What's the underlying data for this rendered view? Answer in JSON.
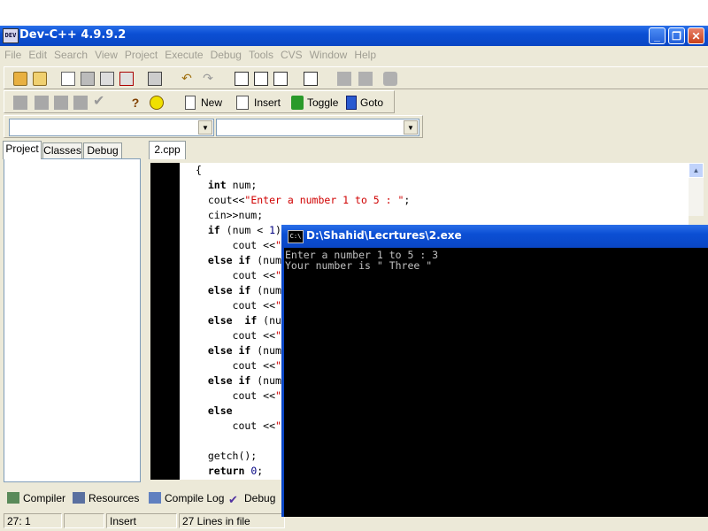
{
  "window": {
    "title": "Dev-C++ 4.9.9.2",
    "app_icon_text": "DEV"
  },
  "menu": [
    "File",
    "Edit",
    "Search",
    "View",
    "Project",
    "Execute",
    "Debug",
    "Tools",
    "CVS",
    "Window",
    "Help"
  ],
  "toolbar2": {
    "new_label": "New",
    "insert_label": "Insert",
    "toggle_label": "Toggle",
    "goto_label": "Goto"
  },
  "left_tabs": [
    "Project",
    "Classes",
    "Debug"
  ],
  "editor": {
    "file_tab": "2.cpp",
    "lines": [
      [
        {
          "t": "{",
          "c": "plain"
        }
      ],
      [
        {
          "t": "  ",
          "c": "plain"
        },
        {
          "t": "int",
          "c": "kw"
        },
        {
          "t": " num;",
          "c": "plain"
        }
      ],
      [
        {
          "t": "  cout<<",
          "c": "plain"
        },
        {
          "t": "\"Enter a number 1 to 5 : \"",
          "c": "str"
        },
        {
          "t": ";",
          "c": "plain"
        }
      ],
      [
        {
          "t": "  cin>>num;",
          "c": "plain"
        }
      ],
      [
        {
          "t": "  ",
          "c": "plain"
        },
        {
          "t": "if",
          "c": "kw"
        },
        {
          "t": " (num < ",
          "c": "plain"
        },
        {
          "t": "1",
          "c": "num"
        },
        {
          "t": ")",
          "c": "plain"
        }
      ],
      [
        {
          "t": "      cout <<",
          "c": "plain"
        },
        {
          "t": "\"",
          "c": "str"
        }
      ],
      [
        {
          "t": "  ",
          "c": "plain"
        },
        {
          "t": "else if",
          "c": "kw"
        },
        {
          "t": " (num",
          "c": "plain"
        }
      ],
      [
        {
          "t": "      cout <<",
          "c": "plain"
        },
        {
          "t": "\"",
          "c": "str"
        }
      ],
      [
        {
          "t": "  ",
          "c": "plain"
        },
        {
          "t": "else if",
          "c": "kw"
        },
        {
          "t": " (num",
          "c": "plain"
        }
      ],
      [
        {
          "t": "      cout <<",
          "c": "plain"
        },
        {
          "t": "\"",
          "c": "str"
        }
      ],
      [
        {
          "t": "  ",
          "c": "plain"
        },
        {
          "t": "else  if",
          "c": "kw"
        },
        {
          "t": " (nu",
          "c": "plain"
        }
      ],
      [
        {
          "t": "      cout <<",
          "c": "plain"
        },
        {
          "t": "\"",
          "c": "str"
        }
      ],
      [
        {
          "t": "  ",
          "c": "plain"
        },
        {
          "t": "else if",
          "c": "kw"
        },
        {
          "t": " (num",
          "c": "plain"
        }
      ],
      [
        {
          "t": "      cout <<",
          "c": "plain"
        },
        {
          "t": "\"",
          "c": "str"
        }
      ],
      [
        {
          "t": "  ",
          "c": "plain"
        },
        {
          "t": "else if",
          "c": "kw"
        },
        {
          "t": " (num",
          "c": "plain"
        }
      ],
      [
        {
          "t": "      cout <<",
          "c": "plain"
        },
        {
          "t": "\"",
          "c": "str"
        }
      ],
      [
        {
          "t": "  ",
          "c": "plain"
        },
        {
          "t": "else",
          "c": "kw"
        }
      ],
      [
        {
          "t": "      cout <<",
          "c": "plain"
        },
        {
          "t": "\"",
          "c": "str"
        }
      ],
      [
        {
          "t": "",
          "c": "plain"
        }
      ],
      [
        {
          "t": "  getch();",
          "c": "plain"
        }
      ],
      [
        {
          "t": "  ",
          "c": "plain"
        },
        {
          "t": "return",
          "c": "kw"
        },
        {
          "t": " ",
          "c": "plain"
        },
        {
          "t": "0",
          "c": "num"
        },
        {
          "t": ";",
          "c": "plain"
        }
      ]
    ]
  },
  "bottom_tabs": [
    "Compiler",
    "Resources",
    "Compile Log",
    "Debug"
  ],
  "status": {
    "position": "27: 1",
    "mode": "Insert",
    "lines": "27 Lines in file"
  },
  "console": {
    "title": "D:\\Shahid\\Lecrtures\\2.exe",
    "icon_text": "C:\\",
    "lines": [
      "Enter a number 1 to 5 : 3",
      "Your number is \" Three \""
    ]
  }
}
